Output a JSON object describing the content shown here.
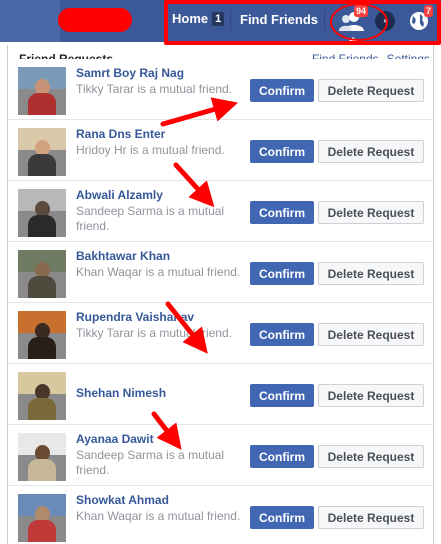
{
  "topbar": {
    "home_label": "Home",
    "home_count": "1",
    "find_friends_label": "Find Friends",
    "friend_requests_badge": "94",
    "notifications_badge": "7",
    "bar_color": "#3b5998",
    "highlight_color": "#ff0000"
  },
  "panel": {
    "title": "Friend Requests",
    "link_find_friends": "Find Friends",
    "separator": "·",
    "link_settings": "Settings"
  },
  "buttons": {
    "confirm": "Confirm",
    "delete": "Delete Request"
  },
  "requests": [
    {
      "name": "Samrt Boy Raj Nag",
      "mutual": "Tikky Tarar is a mutual friend."
    },
    {
      "name": "Rana Dns Enter",
      "mutual": "Hridoy Hr is a mutual friend."
    },
    {
      "name": "Abwali Alzamly",
      "mutual": "Sandeep Sarma is a mutual friend."
    },
    {
      "name": "Bakhtawar Khan",
      "mutual": "Khan Waqar is a mutual friend."
    },
    {
      "name": "Rupendra Vaishanav",
      "mutual": "Tikky Tarar is a mutual friend."
    },
    {
      "name": "Shehan Nimesh",
      "mutual": ""
    },
    {
      "name": "Ayanaa Dawit",
      "mutual": "Sandeep Sarma is a mutual friend."
    },
    {
      "name": "Showkat Ahmad",
      "mutual": "Khan Waqar is a mutual friend."
    }
  ]
}
